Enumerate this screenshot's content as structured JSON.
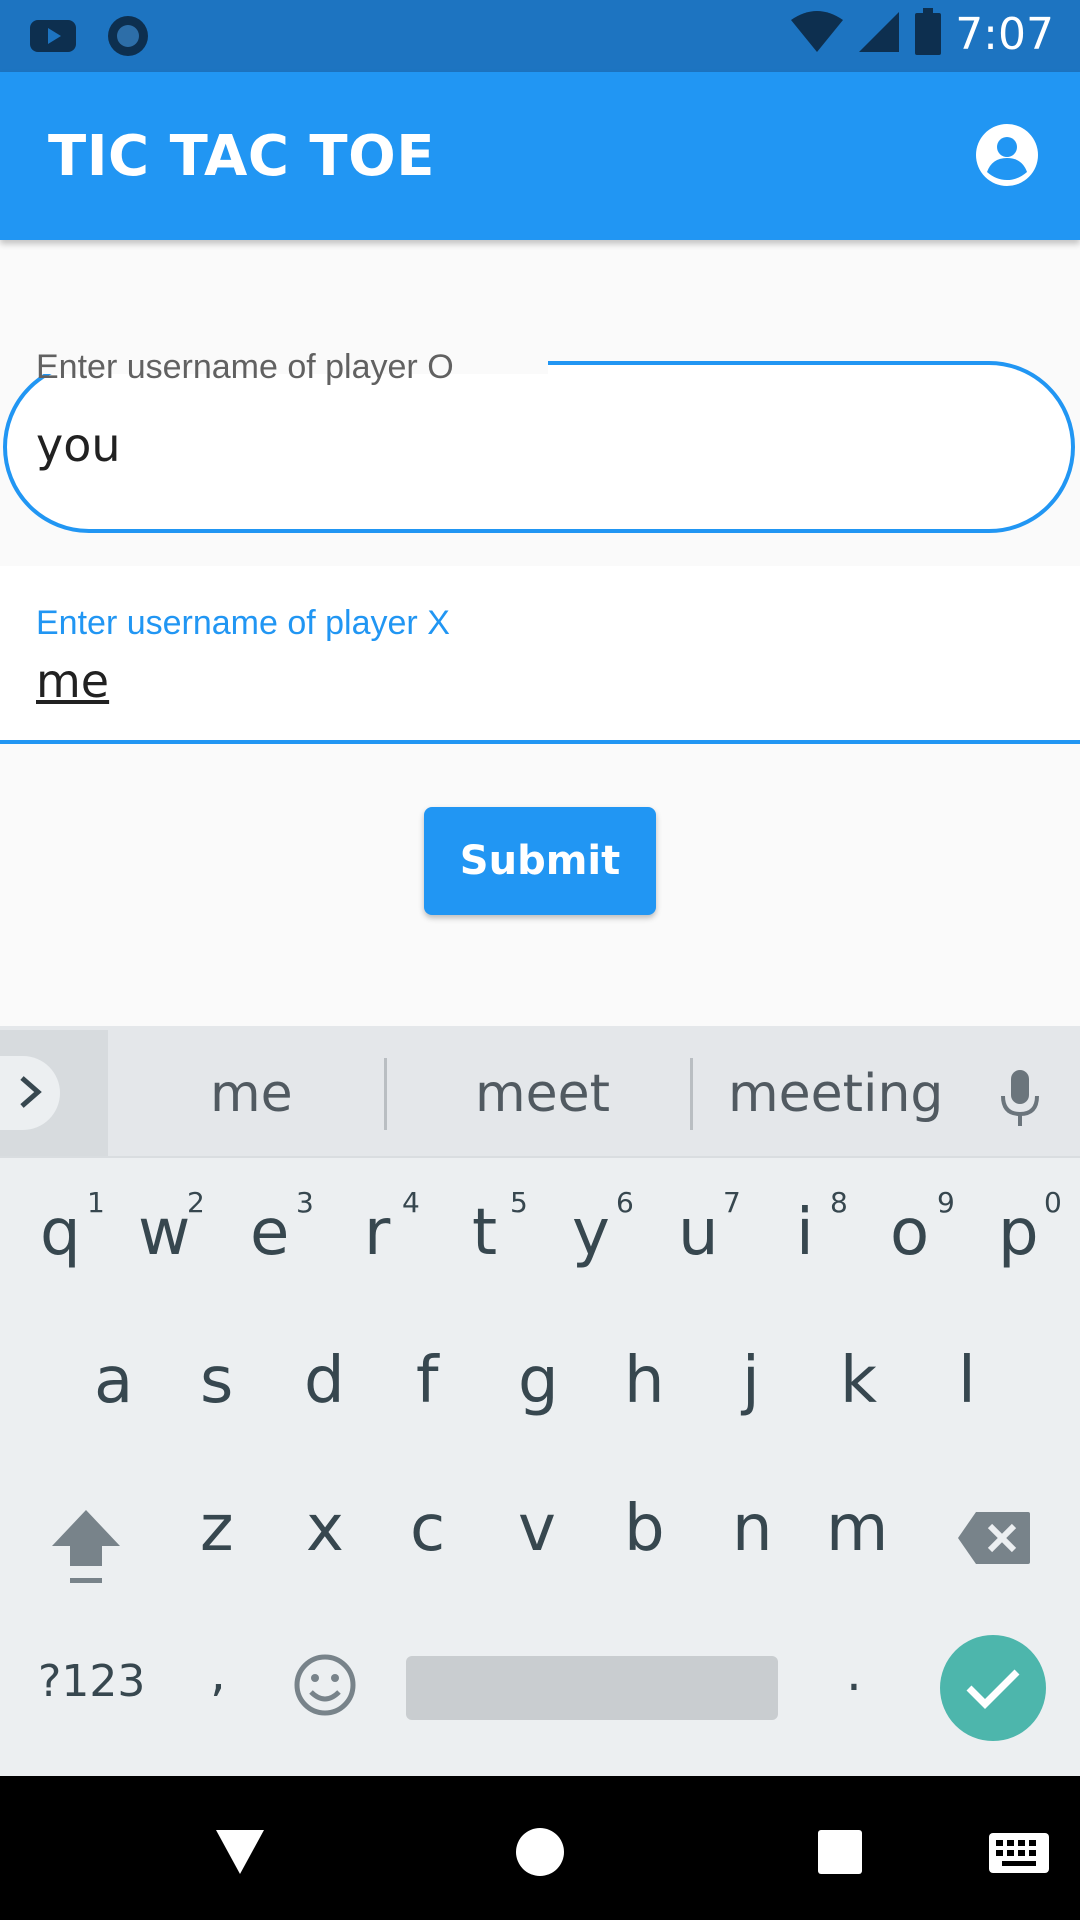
{
  "status_bar": {
    "time": "7:07",
    "icons": [
      "youtube-icon",
      "circle-app-icon",
      "wifi-icon",
      "signal-icon",
      "battery-icon"
    ]
  },
  "app_bar": {
    "title": "TIC TAC TOE",
    "action_icon": "account-circle-icon"
  },
  "form": {
    "player_o": {
      "label": "Enter username of player O",
      "value": "you"
    },
    "player_x": {
      "label": "Enter username of player X",
      "value": "me"
    },
    "submit_label": "Submit"
  },
  "keyboard": {
    "suggestions": [
      "me",
      "meet",
      "meeting"
    ],
    "row1": [
      "q",
      "w",
      "e",
      "r",
      "t",
      "y",
      "u",
      "i",
      "o",
      "p"
    ],
    "row1_hints": [
      "1",
      "2",
      "3",
      "4",
      "5",
      "6",
      "7",
      "8",
      "9",
      "0"
    ],
    "row2": [
      "a",
      "s",
      "d",
      "f",
      "g",
      "h",
      "j",
      "k",
      "l"
    ],
    "row3": [
      "z",
      "x",
      "c",
      "v",
      "b",
      "n",
      "m"
    ],
    "symbols_label": "?123",
    "comma": ",",
    "period": "."
  },
  "colors": {
    "primary": "#2196f3",
    "status_bar": "#1d74c1",
    "keyboard_bg": "#eceff1",
    "done_key": "#4db6ac"
  }
}
